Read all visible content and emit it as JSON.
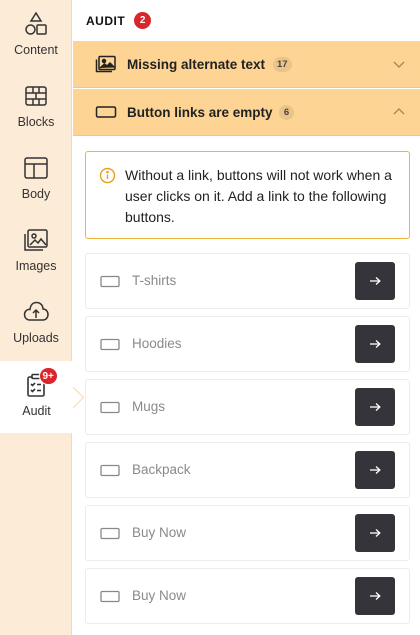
{
  "sidebar": {
    "items": [
      {
        "label": "Content",
        "icon": "shapes-icon"
      },
      {
        "label": "Blocks",
        "icon": "bricks-icon"
      },
      {
        "label": "Body",
        "icon": "layout-icon"
      },
      {
        "label": "Images",
        "icon": "image-icon"
      },
      {
        "label": "Uploads",
        "icon": "cloud-upload-icon"
      },
      {
        "label": "Audit",
        "icon": "clipboard-check-icon",
        "badge": "9+"
      }
    ]
  },
  "audit": {
    "title": "AUDIT",
    "count": "2"
  },
  "sections": [
    {
      "title": "Missing alternate text",
      "count": "17",
      "icon": "image-icon",
      "expanded": false
    },
    {
      "title": "Button links are empty",
      "count": "6",
      "icon": "button-icon",
      "expanded": true
    }
  ],
  "notice": {
    "text": "Without a link, buttons will not work when a user clicks on it. Add a link to the following buttons."
  },
  "buttons": [
    {
      "label": "T-shirts"
    },
    {
      "label": "Hoodies"
    },
    {
      "label": "Mugs"
    },
    {
      "label": "Backpack"
    },
    {
      "label": "Buy Now"
    },
    {
      "label": "Buy Now"
    }
  ],
  "colors": {
    "sidebar_bg": "#fcebd6",
    "accordion_bg": "#fdd493",
    "badge_red": "#d9262c",
    "notice_border": "#f0b33c",
    "action_button": "#34343a"
  }
}
